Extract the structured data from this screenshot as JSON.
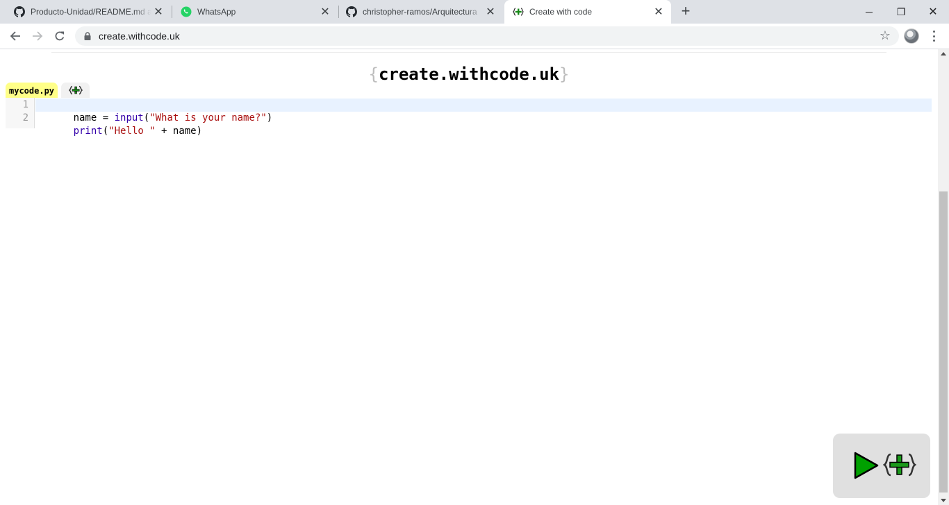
{
  "browser": {
    "tabs": [
      {
        "title": "Producto-Unidad/README.md at",
        "icon": "github-icon",
        "active": false
      },
      {
        "title": "WhatsApp",
        "icon": "whatsapp-icon",
        "active": false
      },
      {
        "title": "christopher-ramos/Arquitectura",
        "icon": "github-icon",
        "active": false
      },
      {
        "title": "Create with code",
        "icon": "create-withcode-logo-icon",
        "active": true
      }
    ],
    "new_tab_label": "+",
    "close_label": "✕",
    "minimize_label": "─",
    "maximize_label": "❐",
    "window_close_label": "✕",
    "url": "create.withcode.uk",
    "bookmark_icon": "☆"
  },
  "page": {
    "brand": {
      "open_brace": "{",
      "text": "create.withcode.uk",
      "close_brace": "}"
    },
    "file_tab": "mycode.py",
    "code": {
      "line_numbers": [
        "1",
        "2"
      ],
      "lines": [
        {
          "tokens": [
            {
              "text": "name = ",
              "kind": "plain"
            },
            {
              "text": "input",
              "kind": "builtin"
            },
            {
              "text": "(",
              "kind": "plain"
            },
            {
              "text": "\"What is your name?\"",
              "kind": "string"
            },
            {
              "text": ")",
              "kind": "plain"
            }
          ]
        },
        {
          "tokens": [
            {
              "text": "print",
              "kind": "builtin"
            },
            {
              "text": "(",
              "kind": "plain"
            },
            {
              "text": "\"Hello \"",
              "kind": "string"
            },
            {
              "text": " + name)",
              "kind": "plain"
            }
          ]
        }
      ]
    },
    "run_panel": {
      "run_icon": "play-icon",
      "logo_icon": "create-withcode-logo-icon"
    }
  },
  "colors": {
    "file_tab_bg": "#ffff88",
    "active_line_bg": "#e8f2ff",
    "builtin": "#3300aa",
    "string": "#aa1111",
    "run_green": "#00a000"
  }
}
